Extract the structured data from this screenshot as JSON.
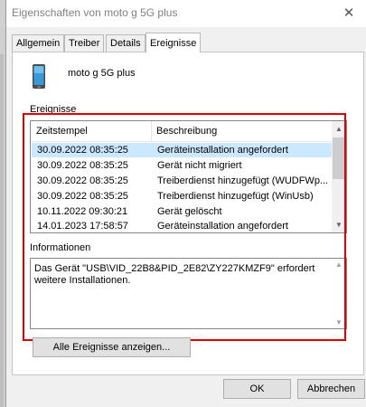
{
  "window": {
    "title": "Eigenschaften von moto g 5G plus",
    "close_glyph": "✕"
  },
  "tabs": [
    {
      "label": "Allgemein"
    },
    {
      "label": "Treiber"
    },
    {
      "label": "Details"
    },
    {
      "label": "Ereignisse",
      "active": true
    }
  ],
  "device": {
    "name": "moto g 5G plus",
    "icon": "phone-icon"
  },
  "events": {
    "label": "Ereignisse",
    "columns": {
      "timestamp": "Zeitstempel",
      "description": "Beschreibung"
    },
    "rows": [
      {
        "ts": "30.09.2022 08:35:25",
        "desc": "Geräteinstallation angefordert"
      },
      {
        "ts": "30.09.2022 08:35:25",
        "desc": "Gerät nicht migriert"
      },
      {
        "ts": "30.09.2022 08:35:25",
        "desc": "Treiberdienst hinzugefügt (WUDFWp..."
      },
      {
        "ts": "30.09.2022 08:35:25",
        "desc": "Treiberdienst hinzugefügt (WinUsb)"
      },
      {
        "ts": "10.11.2022 09:30:21",
        "desc": "Gerät gelöscht"
      },
      {
        "ts": "14.01.2023 17:58:57",
        "desc": "Geräteinstallation angefordert"
      }
    ],
    "selected_index": 0
  },
  "information": {
    "label": "Informationen",
    "text": "Das Gerät \"USB\\VID_22B8&PID_2E82\\ZY227KMZF9\" erfordert weitere Installationen."
  },
  "buttons": {
    "show_all": "Alle Ereignisse anzeigen...",
    "ok": "OK",
    "cancel": "Abbrechen"
  },
  "colors": {
    "highlight_box": "#e00000",
    "selected_row": "#cce8ff"
  }
}
